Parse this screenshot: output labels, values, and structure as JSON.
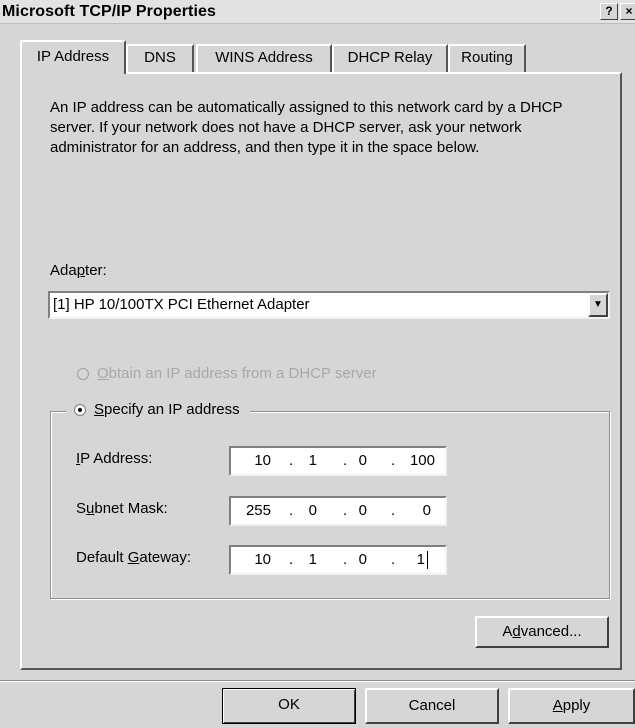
{
  "window": {
    "title": "Microsoft TCP/IP Properties",
    "help_glyph": "?",
    "close_glyph": "×"
  },
  "tabs": [
    {
      "label": "IP Address",
      "active": true
    },
    {
      "label": "DNS",
      "active": false
    },
    {
      "label": "WINS Address",
      "active": false
    },
    {
      "label": "DHCP Relay",
      "active": false
    },
    {
      "label": "Routing",
      "active": false
    }
  ],
  "description": "An IP address can be automatically assigned to this network card by a DHCP server.  If your network does not have a DHCP server, ask your network administrator for an address, and then type it in the space below.",
  "adapter": {
    "label_pre": "Ada",
    "label_accel": "p",
    "label_post": "ter:",
    "selected": "[1] HP 10/100TX PCI Ethernet Adapter",
    "dropdown_glyph": "▼"
  },
  "dhcp_radio": {
    "accel": "O",
    "label_rest": "btain an IP address from a DHCP server",
    "checked": false,
    "enabled": false
  },
  "static_radio": {
    "accel": "S",
    "label_rest": "pecify an IP address",
    "checked": true
  },
  "fields": {
    "ip": {
      "label_accel": "I",
      "label_rest": "P Address:",
      "octets": [
        "10",
        "1",
        "0",
        "100"
      ]
    },
    "subnet": {
      "label_pre": "S",
      "label_accel": "u",
      "label_rest": "bnet Mask:",
      "octets": [
        "255",
        "0",
        "0",
        "0"
      ]
    },
    "gateway": {
      "label_pre": "Default ",
      "label_accel": "G",
      "label_rest": "ateway:",
      "octets": [
        "10",
        "1",
        "0",
        "1"
      ]
    }
  },
  "octet_separator": ".",
  "buttons": {
    "advanced": {
      "pre": "A",
      "accel": "d",
      "rest": "vanced..."
    },
    "ok": "OK",
    "cancel": "Cancel",
    "apply": {
      "accel": "A",
      "rest": "pply"
    }
  }
}
